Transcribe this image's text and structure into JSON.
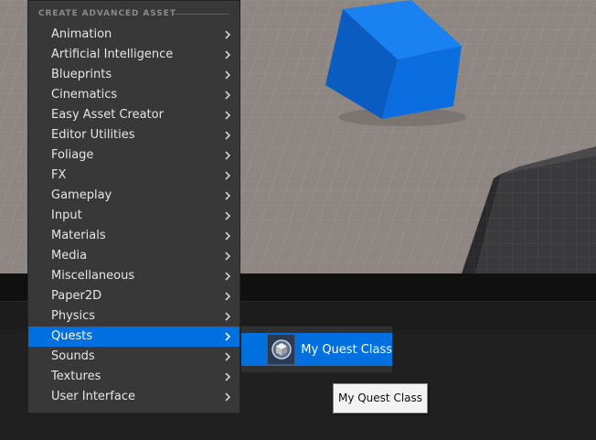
{
  "menu": {
    "header": "CREATE ADVANCED ASSET",
    "items": [
      {
        "label": "Animation"
      },
      {
        "label": "Artificial Intelligence"
      },
      {
        "label": "Blueprints"
      },
      {
        "label": "Cinematics"
      },
      {
        "label": "Easy Asset Creator"
      },
      {
        "label": "Editor Utilities"
      },
      {
        "label": "Foliage"
      },
      {
        "label": "FX"
      },
      {
        "label": "Gameplay"
      },
      {
        "label": "Input"
      },
      {
        "label": "Materials"
      },
      {
        "label": "Media"
      },
      {
        "label": "Miscellaneous"
      },
      {
        "label": "Paper2D"
      },
      {
        "label": "Physics"
      },
      {
        "label": "Quests",
        "active": true
      },
      {
        "label": "Sounds"
      },
      {
        "label": "Textures"
      },
      {
        "label": "User Interface"
      }
    ]
  },
  "submenu": {
    "items": [
      {
        "label": "My Quest Class",
        "icon": "blueprint-class-icon"
      }
    ]
  },
  "tooltip": {
    "text": "My Quest Class"
  },
  "colors": {
    "menu_bg": "#383838",
    "highlight": "#0070e0",
    "cube": "#0a6ee0",
    "floor": "#8b8480"
  }
}
